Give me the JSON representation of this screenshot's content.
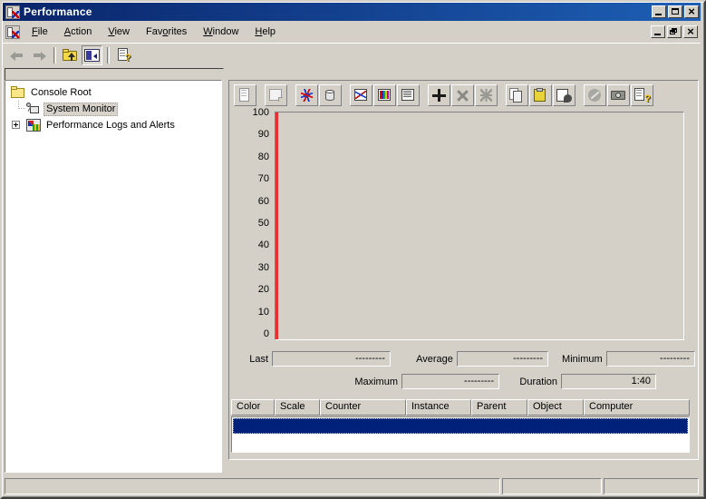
{
  "window": {
    "title": "Performance",
    "icon": "mmc-console-icon",
    "caption_buttons": [
      {
        "name": "minimize",
        "glyph": "_"
      },
      {
        "name": "maximize",
        "glyph": "□"
      },
      {
        "name": "close",
        "glyph": "×"
      }
    ],
    "child_caption_buttons": [
      {
        "name": "minimize",
        "glyph": "_"
      },
      {
        "name": "restore",
        "glyph": "❐"
      },
      {
        "name": "close",
        "glyph": "×"
      }
    ]
  },
  "menubar": {
    "items": [
      {
        "label": "File",
        "accel": "F"
      },
      {
        "label": "Action",
        "accel": "A"
      },
      {
        "label": "View",
        "accel": "V"
      },
      {
        "label": "Favorites",
        "accel": "o"
      },
      {
        "label": "Window",
        "accel": "W"
      },
      {
        "label": "Help",
        "accel": "H"
      }
    ]
  },
  "navtoolbar": {
    "buttons": [
      {
        "name": "back-button",
        "icon": "arrow-left-icon",
        "tooltip": "Back",
        "enabled": false
      },
      {
        "name": "forward-button",
        "icon": "arrow-right-icon",
        "tooltip": "Forward",
        "enabled": false
      },
      {
        "name": "up-one-level-button",
        "icon": "folder-up-icon",
        "tooltip": "Up One Level",
        "enabled": true
      },
      {
        "name": "show-hide-console-tree-button",
        "icon": "console-tree-icon",
        "tooltip": "Show/Hide Console Tree",
        "pressed": true
      },
      {
        "name": "help-button",
        "icon": "help-doc-icon",
        "tooltip": "Help",
        "enabled": true
      }
    ]
  },
  "tree": {
    "items": [
      {
        "label": "Console Root",
        "icon": "folder-icon",
        "level": 0,
        "selected": false,
        "expander": null
      },
      {
        "label": "System Monitor",
        "icon": "system-monitor-icon",
        "level": 1,
        "selected": true,
        "expander": null
      },
      {
        "label": "Performance Logs and Alerts",
        "icon": "perf-logs-icon",
        "level": 1,
        "selected": false,
        "expander": "+"
      }
    ]
  },
  "perf_toolbar": {
    "buttons": [
      {
        "name": "new-counter-set-button",
        "icon": "new-counter-set-icon",
        "tooltip": "New Counter Set"
      },
      {
        "name": "clear-display-button",
        "icon": "clear-display-icon",
        "tooltip": "Clear Display"
      },
      {
        "name": "view-current-activity-button",
        "icon": "view-current-activity-icon",
        "tooltip": "View Current Activity"
      },
      {
        "name": "view-log-data-button",
        "icon": "view-log-data-icon",
        "tooltip": "View Log Data"
      },
      {
        "name": "view-graph-button",
        "icon": "view-graph-icon",
        "tooltip": "View Graph"
      },
      {
        "name": "view-histogram-button",
        "icon": "view-histogram-icon",
        "tooltip": "View Histogram"
      },
      {
        "name": "view-report-button",
        "icon": "view-report-icon",
        "tooltip": "View Report"
      },
      {
        "name": "add-counters-button",
        "icon": "plus-icon",
        "tooltip": "Add"
      },
      {
        "name": "delete-counter-button",
        "icon": "cross-icon",
        "tooltip": "Delete"
      },
      {
        "name": "highlight-button",
        "icon": "highlight-icon",
        "tooltip": "Highlight"
      },
      {
        "name": "copy-properties-button",
        "icon": "copy-icon",
        "tooltip": "Copy Properties"
      },
      {
        "name": "paste-counter-list-button",
        "icon": "paste-icon",
        "tooltip": "Paste Counter List"
      },
      {
        "name": "properties-button",
        "icon": "properties-icon",
        "tooltip": "Properties"
      },
      {
        "name": "freeze-display-button",
        "icon": "freeze-icon",
        "tooltip": "Freeze Display"
      },
      {
        "name": "update-data-button",
        "icon": "camera-icon",
        "tooltip": "Update Data"
      },
      {
        "name": "help-button",
        "icon": "help-doc-icon",
        "tooltip": "Help"
      }
    ]
  },
  "chart_data": {
    "type": "line",
    "title": "",
    "xlabel": "",
    "ylabel": "",
    "ylim": [
      0,
      100
    ],
    "y_ticks": [
      100,
      90,
      80,
      70,
      60,
      50,
      40,
      30,
      20,
      10,
      0
    ],
    "grid": false,
    "series": [],
    "legend_position": "bottom",
    "time_cursor_position_pct": 0,
    "time_cursor_color": "#e83030",
    "plot_background": "#d4d0c8",
    "duration_seconds": 100
  },
  "stats": {
    "rows": [
      [
        {
          "label": "Last",
          "value": "---------",
          "name": "last"
        },
        {
          "label": "Average",
          "value": "---------",
          "name": "average"
        },
        {
          "label": "Minimum",
          "value": "---------",
          "name": "minimum"
        }
      ],
      [
        {
          "label": "Maximum",
          "value": "---------",
          "name": "maximum"
        },
        {
          "label": "Duration",
          "value": "1:40",
          "name": "duration"
        }
      ]
    ]
  },
  "legend": {
    "columns": [
      "Color",
      "Scale",
      "Counter",
      "Instance",
      "Parent",
      "Object",
      "Computer"
    ],
    "rows": [
      {
        "color": "",
        "scale": "",
        "counter": "",
        "instance": "",
        "parent": "",
        "object": "",
        "computer": "",
        "selected": true
      }
    ],
    "selection_color": "#00217a"
  },
  "statusbar": {
    "panes": [
      "",
      "",
      ""
    ]
  }
}
